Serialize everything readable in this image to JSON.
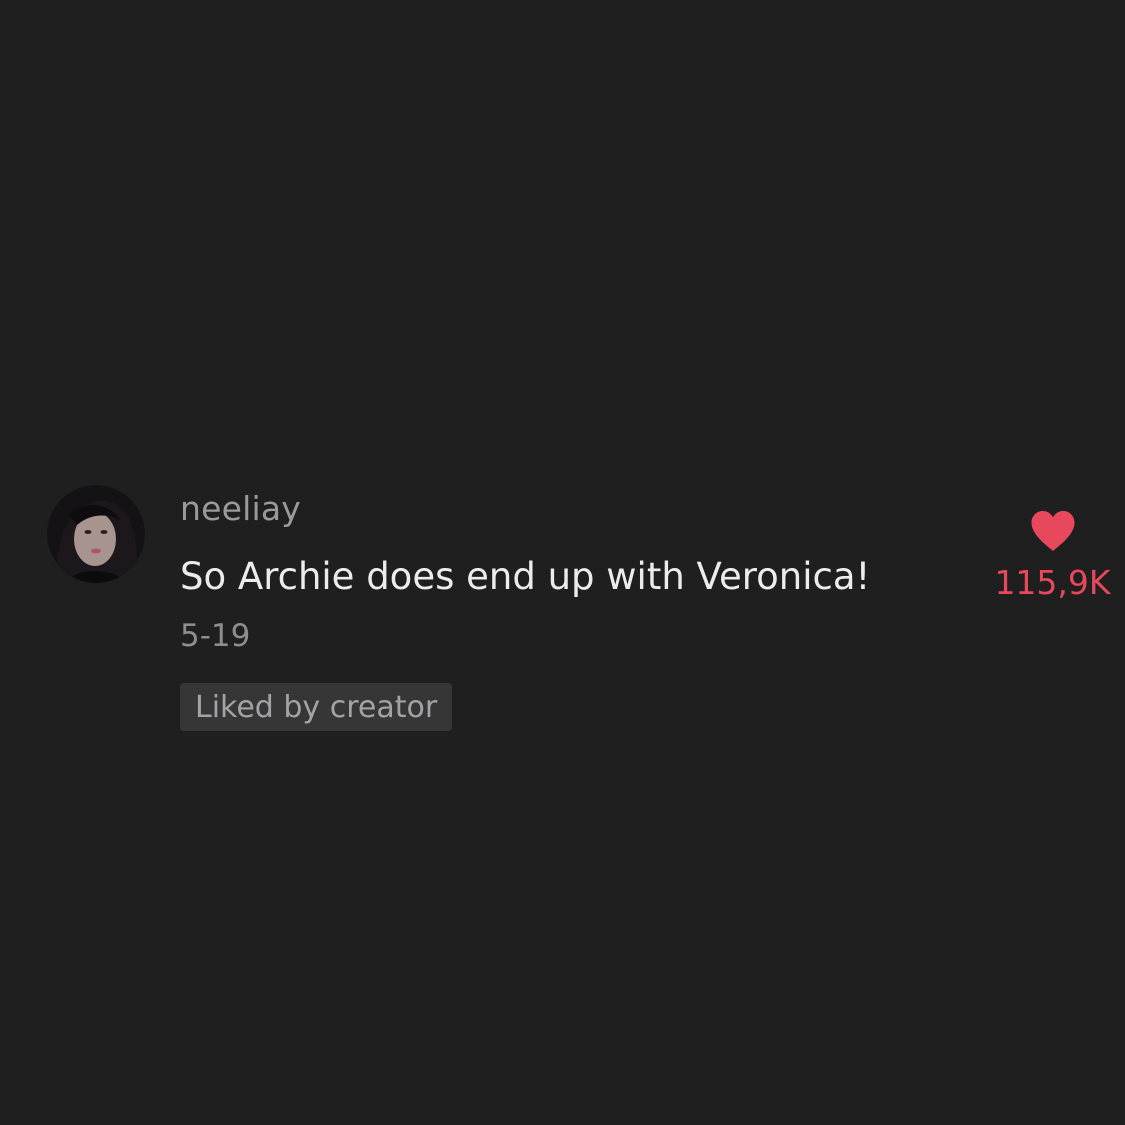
{
  "comment": {
    "username": "neeliay",
    "text": "So Archie does end up with Veronica!",
    "date": "5-19",
    "badge": "Liked by creator",
    "like_count": "115,9K",
    "avatar": "user-avatar-photo",
    "heart_icon": "heart-icon"
  },
  "colors": {
    "background": "#1f1f20",
    "username": "#9a9a9c",
    "text": "#ececec",
    "date": "#8d8d8f",
    "badge_bg": "#363637",
    "badge_text": "#a3a3a5",
    "like": "#e8485c"
  }
}
